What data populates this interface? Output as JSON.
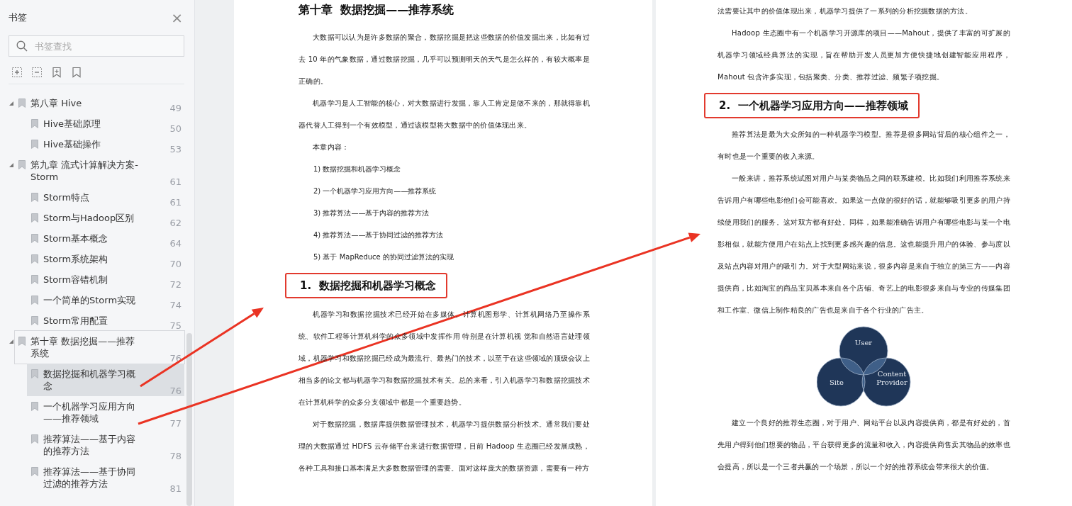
{
  "sidebar": {
    "title": "书签",
    "close_icon": "×",
    "search": {
      "placeholder": "书签查找"
    },
    "bookmarks": [
      {
        "text": "第八章 Hive",
        "page": "49",
        "expanded": true,
        "selected": false,
        "focused": false,
        "children": [
          {
            "text": "Hive基础原理",
            "page": "50",
            "selected": false,
            "focused": false
          },
          {
            "text": "Hive基础操作",
            "page": "53",
            "selected": false,
            "focused": false
          }
        ]
      },
      {
        "text": "第九章 流式计算解决方案-Storm",
        "page": "61",
        "expanded": true,
        "selected": false,
        "focused": false,
        "children": [
          {
            "text": "Storm特点",
            "page": "61",
            "selected": false,
            "focused": false
          },
          {
            "text": "Storm与Hadoop区别",
            "page": "62",
            "selected": false,
            "focused": false
          },
          {
            "text": "Storm基本概念",
            "page": "64",
            "selected": false,
            "focused": false
          },
          {
            "text": "Storm系统架构",
            "page": "70",
            "selected": false,
            "focused": false
          },
          {
            "text": "Storm容错机制",
            "page": "72",
            "selected": false,
            "focused": false
          },
          {
            "text": "一个简单的Storm实现",
            "page": "74",
            "selected": false,
            "focused": false
          },
          {
            "text": "Storm常用配置",
            "page": "75",
            "selected": false,
            "focused": false
          }
        ]
      },
      {
        "text": "第十章 数据挖掘——推荐系统",
        "page": "76",
        "expanded": true,
        "selected": false,
        "focused": true,
        "children": [
          {
            "text": "数据挖掘和机器学习概念",
            "page": "76",
            "selected": true,
            "focused": false
          },
          {
            "text": "一个机器学习应用方向——推荐领域",
            "page": "77",
            "selected": false,
            "focused": false
          },
          {
            "text": "推荐算法——基于内容的推荐方法",
            "page": "78",
            "selected": false,
            "focused": false
          },
          {
            "text": "推荐算法——基于协同过滤的推荐方法",
            "page": "81",
            "selected": false,
            "focused": false
          }
        ]
      }
    ]
  },
  "pages": [
    {
      "blocks": [
        {
          "kind": "title",
          "text": "第十章  数据挖掘——推荐系统"
        },
        {
          "kind": "paragraph",
          "indent": true,
          "text": "大数据可以认为是许多数据的聚合，数据挖掘是把这些数据的价值发掘出来，比如有过去 10 年的气象数据，通过数据挖掘，几乎可以预测明天的天气是怎么样的，有较大概率是正确的。"
        },
        {
          "kind": "paragraph",
          "indent": true,
          "text": "机器学习是人工智能的核心，对大数据进行发掘，靠人工肯定是做不来的，那就得靠机器代替人工得到一个有效模型，通过该模型将大数据中的价值体现出来。"
        },
        {
          "kind": "paragraph",
          "indent": true,
          "text": "本章内容："
        },
        {
          "kind": "list_item",
          "number": "1)",
          "text": "数据挖掘和机器学习概念"
        },
        {
          "kind": "list_item",
          "number": "2)",
          "text": "一个机器学习应用方向——推荐系统"
        },
        {
          "kind": "list_item",
          "number": "3)",
          "text": "推荐算法——基于内容的推荐方法"
        },
        {
          "kind": "list_item",
          "number": "4)",
          "text": "推荐算法——基于协同过滤的推荐方法"
        },
        {
          "kind": "list_item",
          "number": "5)",
          "text": "基于 MapReduce 的协同过滤算法的实现"
        },
        {
          "kind": "heading",
          "number": "1.",
          "text": "数据挖掘和机器学习概念",
          "boxed": true
        },
        {
          "kind": "paragraph",
          "indent": true,
          "text": "机器学习和数据挖掘技术已经开始在多媒体、计算机图形学、计算机网络乃至操作系统、软件工程等计算机科学的众多领域中发挥作用 特别是在计算机视 觉和自然语言处理领域，机器学习和数据挖掘已经成为最流行、最热门的技术，以至于在这些领域的顶级会议上相当多的论文都与机器学习和数据挖掘技术有关。总的来看，引入机器学习和数据挖掘技术在计算机科学的众多分支领域中都是一个重要趋势。"
        },
        {
          "kind": "paragraph",
          "indent": true,
          "text": "对于数据挖掘，数据库提供数据管理技术，机器学习提供数据分析技术。通常我们要处理的大数据通过 HDFS 云存储平台来进行数据管理，目前 Hadoop 生态圈已经发展成熟，各种工具和接口基本满足大多数数据管理的需要。面对这样庞大的数据资源，需要有一种方"
        }
      ]
    },
    {
      "blocks": [
        {
          "kind": "paragraph",
          "indent": false,
          "text": "法需要让其中的价值体现出来，机器学习提供了一系列的分析挖掘数据的方法。"
        },
        {
          "kind": "paragraph",
          "indent": true,
          "text": "Hadoop 生态圈中有一个机器学习开源库的项目——Mahout，提供了丰富的可扩展的机器学习领域经典算法的实现，旨在帮助开发人员更加方便快捷地创建智能应用程序，Mahout 包含许多实现，包括聚类、分类、推荐过滤、频繁子项挖掘。"
        },
        {
          "kind": "heading",
          "number": "2.",
          "text": "一个机器学习应用方向——推荐领域",
          "boxed": true
        },
        {
          "kind": "paragraph",
          "indent": true,
          "text": "推荐算法是最为大众所知的一种机器学习模型。推荐是很多网站背后的核心组件之一，有时也是一个重要的收入来源。"
        },
        {
          "kind": "paragraph",
          "indent": true,
          "text": "一般来讲，推荐系统试图对用户与某类物品之间的联系建模。比如我们利用推荐系统来告诉用户有哪些电影他们会可能喜欢。如果这一点做的很好的话，就能够吸引更多的用户持续使用我们的服务。这对双方都有好处。同样，如果能准确告诉用户有哪些电影与某一个电影相似，就能方便用户在站点上找到更多感兴趣的信息。这也能提升用户的体验、参与度以及站点内容对用户的吸引力。对于大型网站来说，很多内容是来自于独立的第三方——内容提供商，比如淘宝的商品宝贝基本来自各个店铺、奇艺上的电影很多来自与专业的传媒集团和工作室、微信上制作精良的广告也是来自于各个行业的广告主。"
        },
        {
          "kind": "figure",
          "circles": [
            {
              "lines": [
                "User"
              ]
            },
            {
              "lines": [
                "Site"
              ]
            },
            {
              "lines": [
                "Content",
                "Provider"
              ]
            }
          ]
        },
        {
          "kind": "paragraph",
          "indent": true,
          "text": "建立一个良好的推荐生态圈，对于用户、网站平台以及内容提供商，都是有好处的，首先用户得到他们想要的物品，平台获得更多的流量和收入，内容提供商售卖其物品的效率也会提高，所以是一个三者共赢的一个场景，所以一个好的推荐系统会带来很大的价值。"
        }
      ]
    }
  ]
}
